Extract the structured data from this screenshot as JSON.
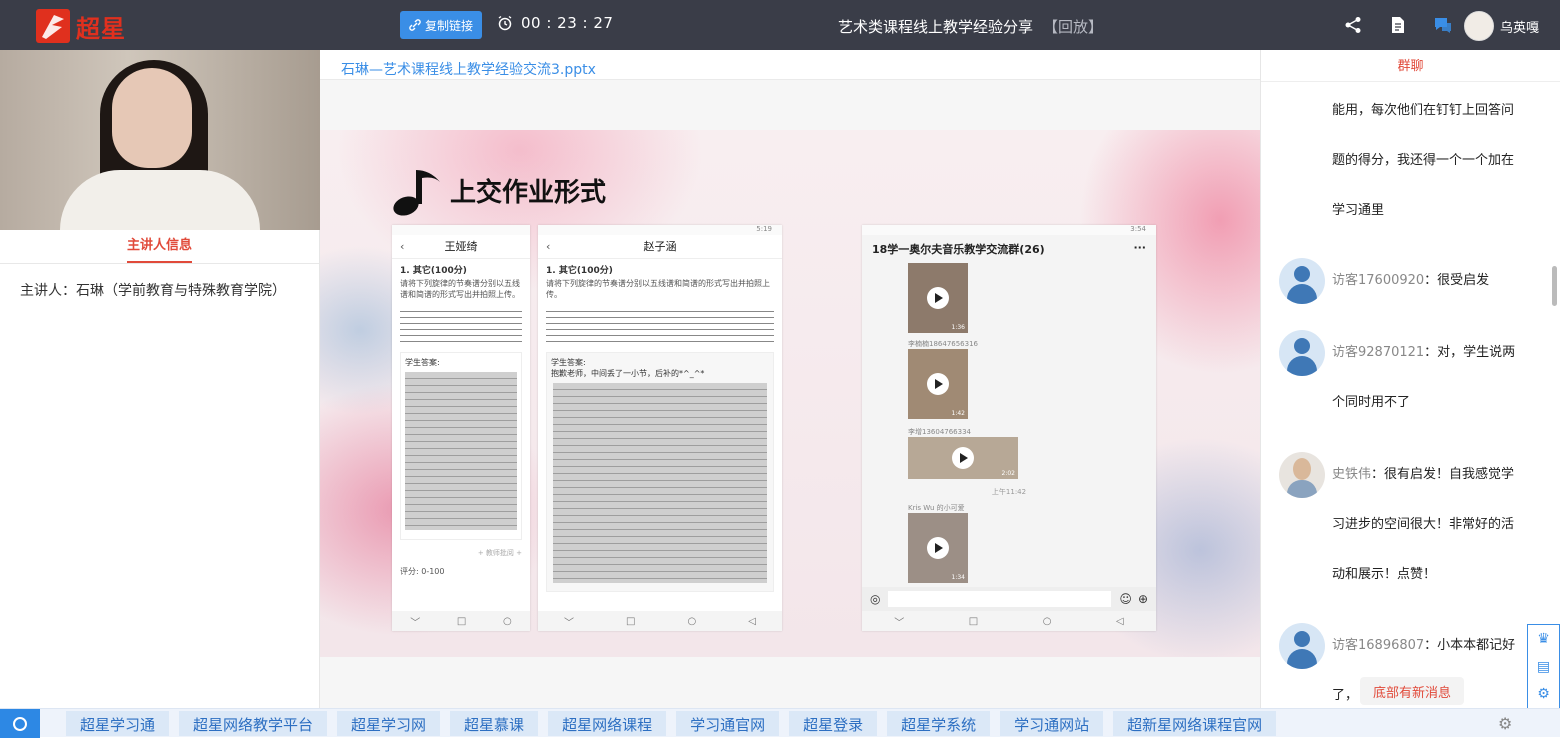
{
  "app": {
    "logo_text": "超星"
  },
  "topbar": {
    "copy_button": "复制链接",
    "timer": "00 : 23 : 27",
    "title": "艺术类课程线上教学经验分享",
    "replay_tag": "【回放】",
    "user_name": "乌英嘎"
  },
  "left": {
    "tab_label": "主讲人信息",
    "speaker_info": "主讲人：石琳（学前教育与特殊教育学院）"
  },
  "center": {
    "filename": "石琳—艺术课程线上教学经验交流3.pptx",
    "slide": {
      "title": "上交作业形式",
      "phone1": {
        "header": "王娅绮",
        "question": "1. 其它(100分)",
        "desc": "请将下列旋律的节奏谱分别以五线谱和简谱的形式写出并拍照上传。",
        "answer_label": "学生答案:",
        "score_label": "评分: 0-100",
        "teacher_comment": "+ 教师批阅 +"
      },
      "phone2": {
        "header": "赵子涵",
        "question": "1. 其它(100分)",
        "desc": "请将下列旋律的节奏谱分别以五线谱和简谱的形式写出并拍照上传。",
        "answer_label": "学生答案:",
        "answer_note": "抱歉老师，中间丢了一小节，后补的*^_^*",
        "time": "5:19"
      },
      "phone3": {
        "header": "18学一奥尔夫音乐教学交流群(26)",
        "time": "3:54",
        "sender1": "李楠楠18647656316",
        "sender2": "李增13604766334",
        "timestamp": "上午11:42",
        "sender3": "Kris Wu 的小可爱",
        "dur1": "1:36",
        "dur2": "1:42",
        "dur3": "2:02",
        "dur4": "1:34"
      }
    }
  },
  "chat": {
    "tab_label": "群聊",
    "messages": [
      {
        "name": "",
        "text_lines": [
          "能用，每次他们在钉钉上回答问",
          "题的得分，我还得一个一个加在",
          "学习通里"
        ]
      },
      {
        "name": "访客17600920",
        "text": "：很受启发"
      },
      {
        "name": "访客92870121",
        "text": "：对，学生说两",
        "text2": "个同时用不了"
      },
      {
        "name": "史铁伟",
        "text": "：很有启发！自我感觉学",
        "text2": "习进步的空间很大！非常好的活",
        "text3": "动和展示！点赞！"
      },
      {
        "name": "访客16896807",
        "text": "：小本本都记好",
        "text2": "了，"
      }
    ],
    "new_msg": "底部有新消息"
  },
  "bottombar": {
    "links": [
      "超星学习通",
      "超星网络教学平台",
      "超星学习网",
      "超星慕课",
      "超星网络课程",
      "学习通官网",
      "超星登录",
      "超星学系统",
      "学习通网站",
      "超新星网络课程官网"
    ]
  },
  "colors": {
    "topbar": "#3a3d48",
    "accent_red": "#e14a3a",
    "accent_blue": "#3a8ee6"
  }
}
